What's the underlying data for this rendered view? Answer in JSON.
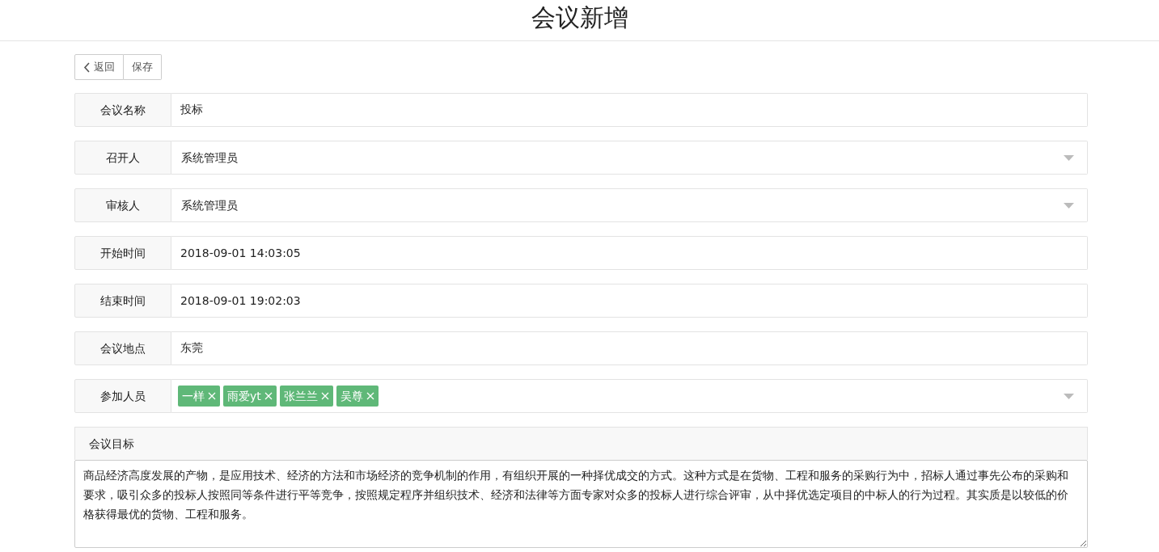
{
  "page_title": "会议新增",
  "toolbar": [
    {
      "kind": "back",
      "label": "返回"
    },
    {
      "kind": "plain",
      "label": "保存"
    }
  ],
  "fields": [
    {
      "kind": "text",
      "label": "会议名称",
      "value": "投标"
    },
    {
      "kind": "select",
      "label": "召开人",
      "value": "系统管理员"
    },
    {
      "kind": "select",
      "label": "审核人",
      "value": "系统管理员"
    },
    {
      "kind": "text",
      "label": "开始时间",
      "value": "2018-09-01 14:03:05"
    },
    {
      "kind": "text",
      "label": "结束时间",
      "value": "2018-09-01 19:02:03"
    },
    {
      "kind": "text",
      "label": "会议地点",
      "value": "东莞"
    },
    {
      "kind": "tags",
      "label": "参加人员",
      "tags": [
        "一样",
        "雨爱yt",
        "张兰兰",
        "吴尊"
      ]
    }
  ],
  "goal": {
    "label": "会议目标",
    "value": "商品经济高度发展的产物，是应用技术、经济的方法和市场经济的竞争机制的作用，有组织开展的一种择优成交的方式。这种方式是在货物、工程和服务的采购行为中，招标人通过事先公布的采购和要求，吸引众多的投标人按照同等条件进行平等竞争，按照规定程序并组织技术、经济和法律等方面专家对众多的投标人进行综合评审，从中择优选定项目的中标人的行为过程。其实质是以较低的价格获得最优的货物、工程和服务。"
  }
}
